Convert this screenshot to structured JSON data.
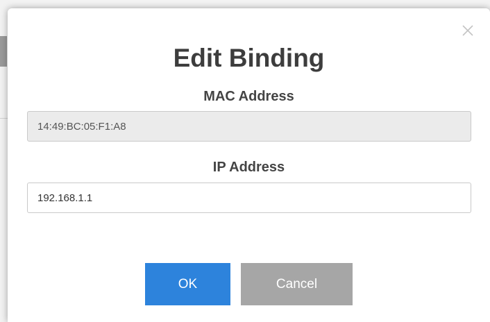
{
  "dialog": {
    "title": "Edit Binding",
    "close_icon": "close-icon",
    "mac_address": {
      "label": "MAC Address",
      "value": "14:49:BC:05:F1:A8",
      "disabled": true
    },
    "ip_address": {
      "label": "IP Address",
      "value": "192.168.1.1"
    },
    "buttons": {
      "ok_label": "OK",
      "cancel_label": "Cancel"
    }
  },
  "colors": {
    "primary": "#2d83dc",
    "secondary": "#a6a6a6",
    "disabled_field": "#ebebeb",
    "text": "#3d3d3d"
  }
}
